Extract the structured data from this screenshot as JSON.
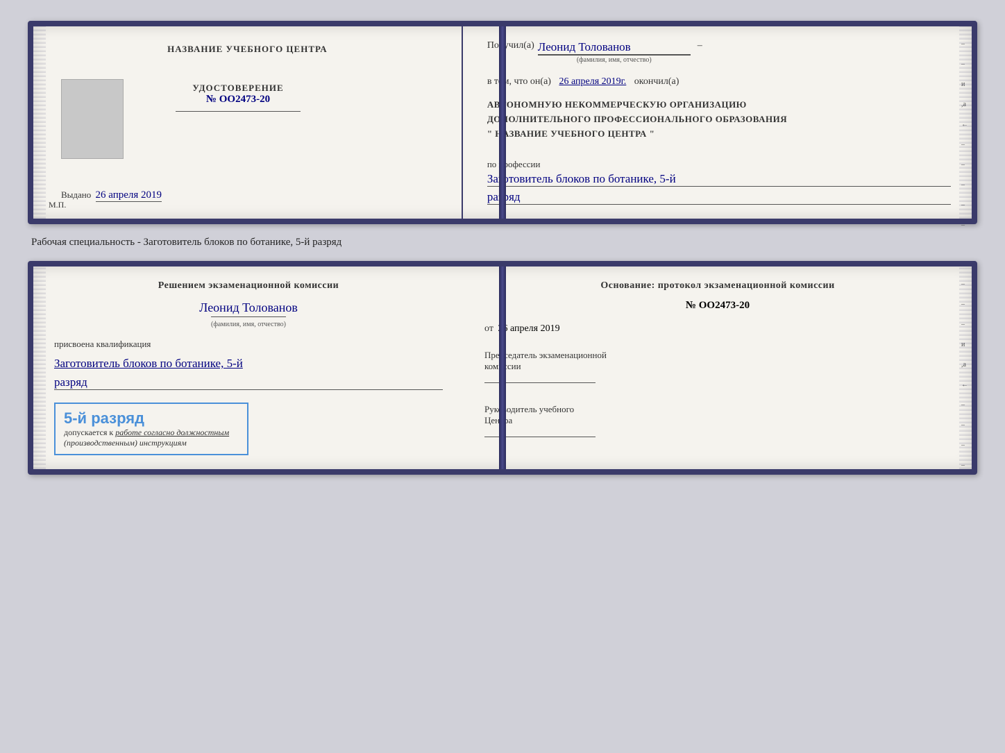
{
  "card1": {
    "left": {
      "center_name": "НАЗВАНИЕ УЧЕБНОГО ЦЕНТРА",
      "udost_title": "УДОСТОВЕРЕНИЕ",
      "udost_number": "№ OO2473-20",
      "vydano_label": "Выдано",
      "vydano_date": "26 апреля 2019",
      "mp_label": "М.П."
    },
    "right": {
      "poluchil_label": "Получил(a)",
      "fio_value": "Леонид Толованов",
      "fio_sublabel": "(фамилия, имя, отчество)",
      "vtom_text": "в том, что он(а)",
      "vtom_date": "26 апреля 2019г.",
      "okonchil": "окончил(а)",
      "org_line1": "АВТОНОМНУЮ НЕКОММЕРЧЕСКУЮ ОРГАНИЗАЦИЮ",
      "org_line2": "ДОПОЛНИТЕЛЬНОГО ПРОФЕССИОНАЛЬНОГО ОБРАЗОВАНИЯ",
      "org_line3": "\"  НАЗВАНИЕ УЧЕБНОГО ЦЕНТРА  \"",
      "po_professii": "по профессии",
      "profession": "Заготовитель блоков по ботанике, 5-й",
      "razryad": "разряд"
    }
  },
  "subtitle": "Рабочая специальность - Заготовитель блоков по ботанике, 5-й разряд",
  "card2": {
    "left": {
      "resheniem_text": "Решением экзаменационной комиссии",
      "fio_value": "Леонид Толованов",
      "fio_sublabel": "(фамилия, имя, отчество)",
      "prisvoena": "присвоена квалификация",
      "kvalif_line1": "Заготовитель блоков по ботанике, 5-й",
      "razryad": "разряд",
      "stamp_main": "5-й разряд",
      "stamp_sub1": "допускается к",
      "stamp_sub2": "работе согласно должностным",
      "stamp_sub3": "(производственным) инструкциям"
    },
    "right": {
      "osnov_text": "Основание: протокол экзаменационной комиссии",
      "proto_number": "№  OO2473-20",
      "ot_label": "от",
      "ot_date": "26 апреля 2019",
      "predsedatel_line1": "Председатель экзаменационной",
      "predsedatel_line2": "комиссии",
      "rukovod_line1": "Руководитель учебного",
      "rukovod_line2": "Центра"
    }
  }
}
